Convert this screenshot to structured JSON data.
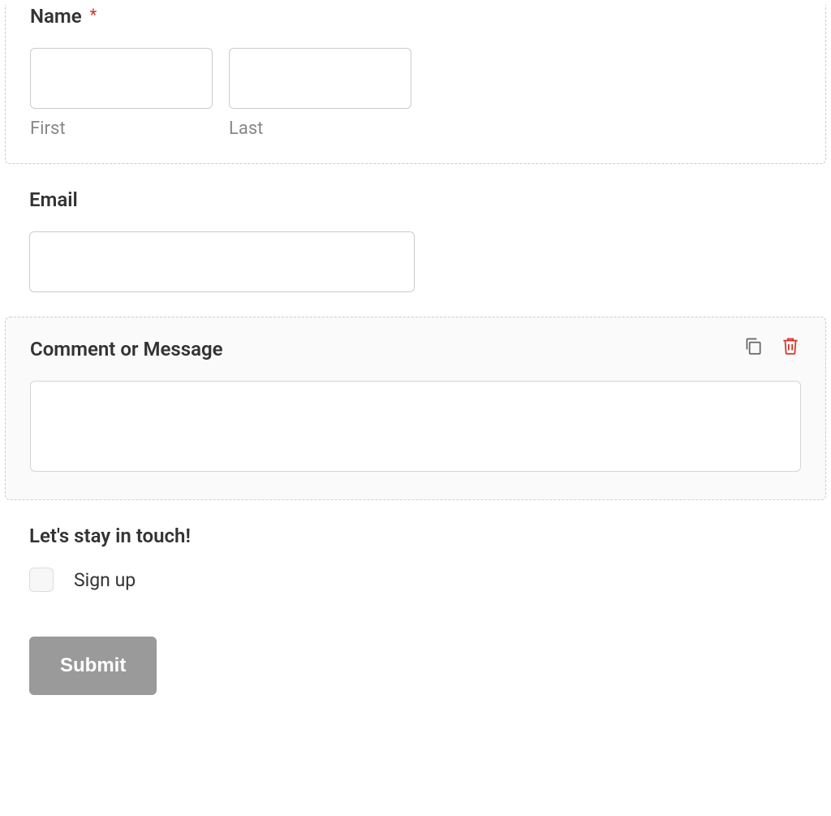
{
  "name_field": {
    "label": "Name",
    "required_marker": "*",
    "first_sublabel": "First",
    "last_sublabel": "Last",
    "first_value": "",
    "last_value": ""
  },
  "email_field": {
    "label": "Email",
    "value": ""
  },
  "message_field": {
    "label": "Comment or Message",
    "value": ""
  },
  "stay_in_touch": {
    "label": "Let's stay in touch!",
    "option_label": "Sign up"
  },
  "submit": {
    "label": "Submit"
  }
}
